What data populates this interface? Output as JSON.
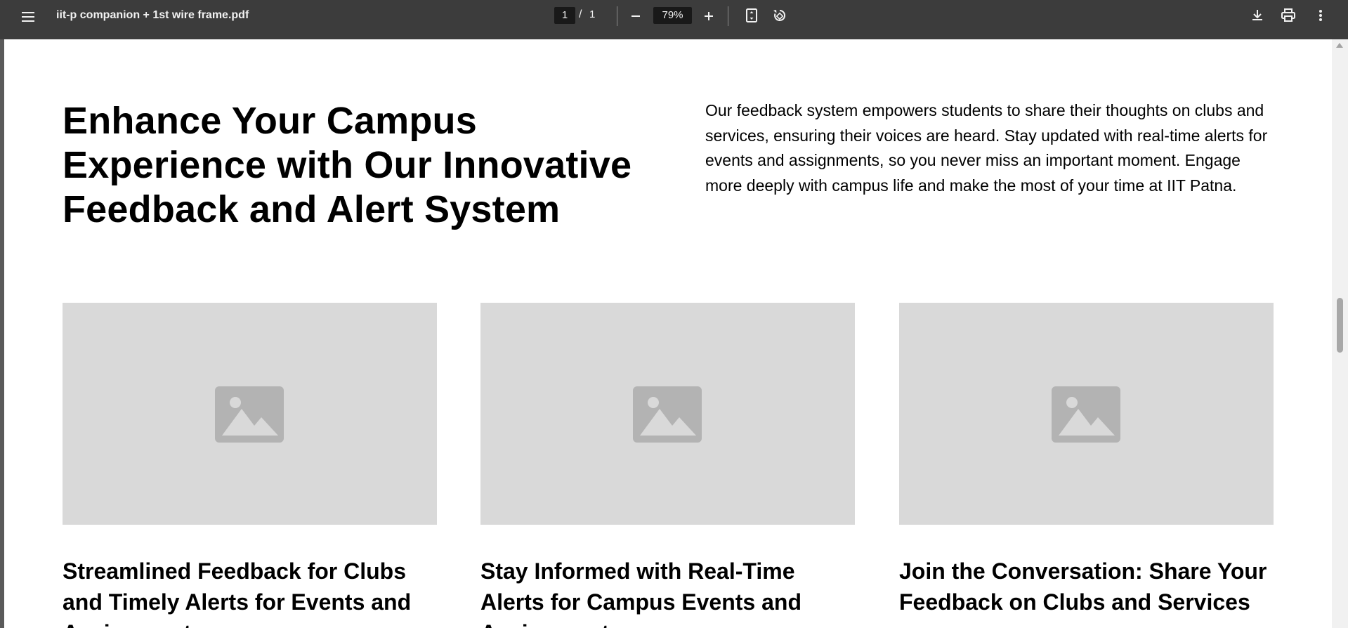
{
  "toolbar": {
    "menu_icon": "hamburger-menu-icon",
    "title": "iit-p companion + 1st wire frame.pdf",
    "page_current": "1",
    "page_separator": "/",
    "page_total": "1",
    "zoom": "79%",
    "icons": [
      "zoom-out-icon",
      "zoom-in-icon",
      "fit-page-icon",
      "rotate-icon",
      "download-icon",
      "print-icon",
      "more-vert-icon"
    ]
  },
  "document": {
    "hero_title": "Enhance Your Campus Experience with Our Innovative Feedback and Alert System",
    "hero_description": "Our feedback system empowers students to share their thoughts on clubs and services, ensuring their voices are heard. Stay updated with real-time alerts for events and assignments, so you never miss an important moment. Engage more deeply with campus life and make the most of your time at IIT Patna.",
    "cards": [
      {
        "title": "Streamlined Feedback for Clubs and Timely Alerts for Events and Assignments",
        "image_icon": "image-placeholder-icon"
      },
      {
        "title": "Stay Informed with Real-Time Alerts for Campus Events and Assignments",
        "image_icon": "image-placeholder-icon"
      },
      {
        "title": "Join the Conversation: Share Your Feedback on Clubs and Services",
        "image_icon": "image-placeholder-icon"
      }
    ]
  },
  "colors": {
    "toolbar_bg": "#3c3c3c",
    "page_bg": "#ffffff",
    "placeholder_bg": "#d9d9d9",
    "placeholder_icon": "#b3b3b3"
  }
}
